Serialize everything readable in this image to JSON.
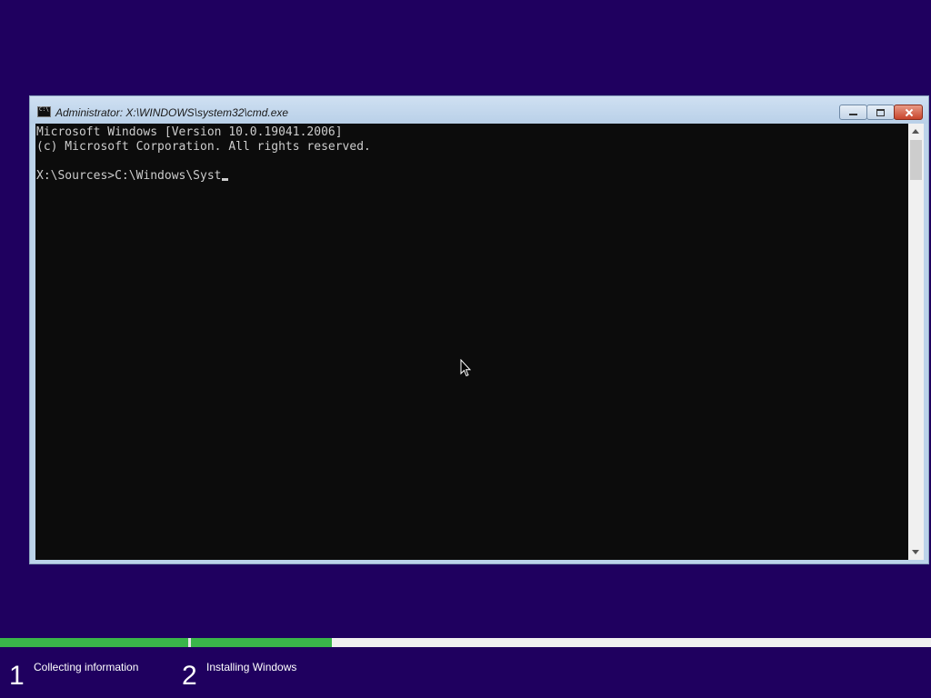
{
  "window": {
    "title": "Administrator: X:\\WINDOWS\\system32\\cmd.exe",
    "app_icon": "cmd-icon",
    "buttons": {
      "minimize_icon": "minimize-icon",
      "maximize_icon": "maximize-icon",
      "close_icon": "close-icon"
    }
  },
  "console": {
    "lines": [
      "Microsoft Windows [Version 10.0.19041.2006]",
      "(c) Microsoft Corporation. All rights reserved.",
      "",
      "X:\\Sources>C:\\Windows\\Syst"
    ],
    "background": "#0c0c0c",
    "foreground": "#cccccc"
  },
  "setup": {
    "steps": [
      {
        "number": "1",
        "label": "Collecting information",
        "progress": 1.0
      },
      {
        "number": "2",
        "label": "Installing Windows",
        "progress": 0.19
      }
    ],
    "progress_color": "#3ab54a",
    "background": "#1f005f"
  }
}
